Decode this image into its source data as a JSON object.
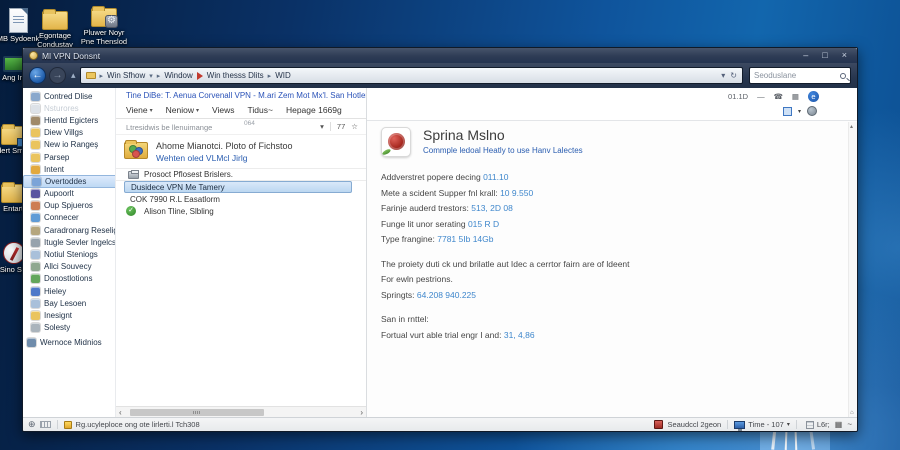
{
  "icons": {
    "caret_down": "▾",
    "crumb_sep": "▸",
    "back_arrow": "←",
    "forward_arrow": "→",
    "refresh": "↻",
    "star": "☆",
    "chevron_left": "‹",
    "chevron_right": "›",
    "clock": "⊕",
    "phone": "☎",
    "grid": "▦",
    "dash": "—",
    "up": "▴",
    "home": "⌂",
    "check": "✓",
    "help_letter": "e",
    "tilde": "~"
  },
  "desktop": {
    "icons_top": [
      {
        "label": "MB Sydoenk"
      },
      {
        "label": "Egontage Condustay"
      },
      {
        "label": "Pluwer Noyr Pne Thenslod Suneet"
      }
    ],
    "icons_left": [
      {
        "label": "Ang Im"
      },
      {
        "label": "Aldert Smdala"
      },
      {
        "label": "Entarti"
      },
      {
        "label": "Sino Sta"
      }
    ]
  },
  "window": {
    "title": "Ml VPN Donsnt",
    "controls": {
      "minimize": "–",
      "maximize": "□",
      "close": "×"
    },
    "nav": {
      "breadcrumb": [
        "Win Sfhow",
        "Window",
        "Win thesss Dlits",
        "WID"
      ],
      "search_text": "Seoduslane"
    },
    "sidebar": {
      "items": [
        {
          "label": "Contred Dlise",
          "style": "background:#8aa8cc"
        },
        {
          "label": "Nsturores",
          "style": "background:#dde2e8"
        },
        {
          "label": "Hientd Egicters",
          "style": "background:#a08a6a"
        },
        {
          "label": "Diew Villgs",
          "style": "background:#eac45e"
        },
        {
          "label": "New io Rangeş",
          "style": "background:#eac45e"
        },
        {
          "label": "Parsep",
          "style": "background:#eac45e"
        },
        {
          "label": "Intent",
          "style": "background:#e2a93f"
        },
        {
          "label": "Overtoddes",
          "style": "background:#7ba4d8"
        },
        {
          "label": "Aupoorlt",
          "style": "background:#5a55a0"
        },
        {
          "label": "Oup Spjueros",
          "style": "background:#cd7d52"
        },
        {
          "label": "Connecer",
          "style": "background:#5f9bd6"
        },
        {
          "label": "Caradronarg Reseligit",
          "style": "background:#b5a67e"
        },
        {
          "label": "Itugle Sevler Ingelcs",
          "style": "background:#97a3ad"
        },
        {
          "label": "Notiul Steniogs",
          "style": "background:#a9c0da"
        },
        {
          "label": "Allci Souvecy",
          "style": "background:#8fa890"
        },
        {
          "label": "Donostlotions",
          "style": "background:#63a65b"
        },
        {
          "label": "Hieley",
          "style": "background:#4f79c9"
        },
        {
          "label": "Bay Lesoen",
          "style": "background:#a9c0da"
        },
        {
          "label": "Inesignt",
          "style": "background:#eac45e"
        },
        {
          "label": "Solesty",
          "style": "background:#aab4bc"
        },
        {
          "label": "Wernoce Midnios",
          "style": "background:#6f8cab"
        }
      ]
    },
    "middle": {
      "heading": "Tine DiBe: T. Aenua Corvenall VPN - M.ari Zem Mot Mx'l. San Hotlery",
      "menus": [
        "Viene",
        "Neniow",
        "Views",
        "Tidus~",
        "Hepage 1669g"
      ],
      "filter": {
        "label": "Ltresidwis be llenuimange",
        "center": "064",
        "count": "77"
      },
      "featured": {
        "title": "Ahome Mianotci. Ploto of Fichstoo",
        "link": "Wehten oled VLMcl Jirlg"
      },
      "rows": [
        {
          "title": "Prosoct Pflosest Brislers."
        },
        {
          "title": "Dusidece VPN Me Tamery"
        },
        {
          "title": "COK 7990 R.L Easatlorm"
        },
        {
          "title": "Alison Tline, Slbling"
        }
      ]
    },
    "details": {
      "zoom_level": "01.1D",
      "app_name": "Sprina Mslno",
      "tagline": "Commple ledoal Heatly to use Hanv Lalectes",
      "rows": [
        {
          "label": "Addverstret popere decing",
          "value": "011.10"
        },
        {
          "label": "Mete a scident Supper fnl krall:",
          "value": "10 9.550"
        },
        {
          "label": "Farinje auderd trestors:",
          "value": "513, 2D 08"
        },
        {
          "label": "Funge lit unor serating",
          "value": "015 R D"
        },
        {
          "label": "Type frangine:",
          "value": "7781 5Ib 14Gb"
        }
      ],
      "para1": "The proiety duti ck und brilatle aut Idec a cerrtor fairn are of ldeent",
      "para2": "For ewln pestrions.",
      "row6": {
        "label": "Springts:",
        "value": "64.208 940.225"
      },
      "para3": "San in rnttel:",
      "row7": {
        "label": "Fortual vurt able trial engr I and:",
        "value": "31, 4,86"
      }
    },
    "statusbar": {
      "left_text": "Rg.ucyleploce ong ote lirlerti.l Tch308",
      "device": "Seaudccl 2geon",
      "display": "Time - 107",
      "right_small": "L6r;"
    }
  }
}
